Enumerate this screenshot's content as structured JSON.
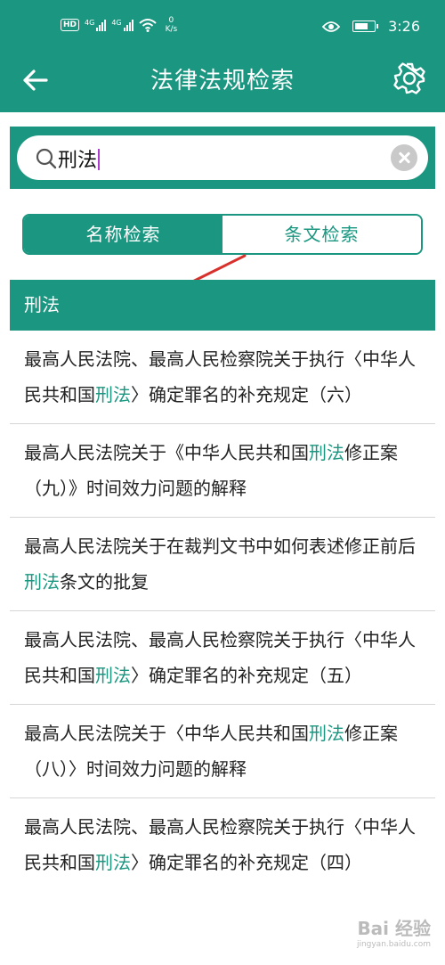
{
  "status": {
    "hd": "HD",
    "net1": "4G",
    "net2": "4G",
    "speed_value": "0",
    "speed_unit": "K/s",
    "time": "3:26"
  },
  "navbar": {
    "title": "法律法规检索"
  },
  "search": {
    "value": "刑法"
  },
  "tabs": [
    {
      "label": "名称检索",
      "active": true
    },
    {
      "label": "条文检索",
      "active": false
    }
  ],
  "section": {
    "title": "刑法"
  },
  "results": [
    {
      "before": "最高人民法院、最高人民检察院关于执行〈中华人民共和国",
      "keyword": "刑法",
      "after": "〉确定罪名的补充规定（六）"
    },
    {
      "before": "最高人民法院关于《中华人民共和国",
      "keyword": "刑法",
      "after": "修正案（九）》时间效力问题的解释"
    },
    {
      "before": "最高人民法院关于在裁判文书中如何表述修正前后",
      "keyword": "刑法",
      "after": "条文的批复"
    },
    {
      "before": "最高人民法院、最高人民检察院关于执行〈中华人民共和国",
      "keyword": "刑法",
      "after": "〉确定罪名的补充规定（五）"
    },
    {
      "before": "最高人民法院关于〈中华人民共和国",
      "keyword": "刑法",
      "after": "修正案（八）〉时间效力问题的解释"
    },
    {
      "before": "最高人民法院、最高人民检察院关于执行〈中华人民共和国",
      "keyword": "刑法",
      "after": "〉确定罪名的补充规定（四）"
    }
  ],
  "watermark": {
    "brand": "Bai 经验",
    "url": "jingyan.baidu.com"
  },
  "colors": {
    "primary": "#1b9680",
    "caret": "#b03bd2",
    "arrow": "#d9302c"
  },
  "icons": {
    "back": "arrow-left-icon",
    "settings": "gear-icon",
    "search": "magnifier-icon",
    "clear": "close-circle-icon"
  }
}
